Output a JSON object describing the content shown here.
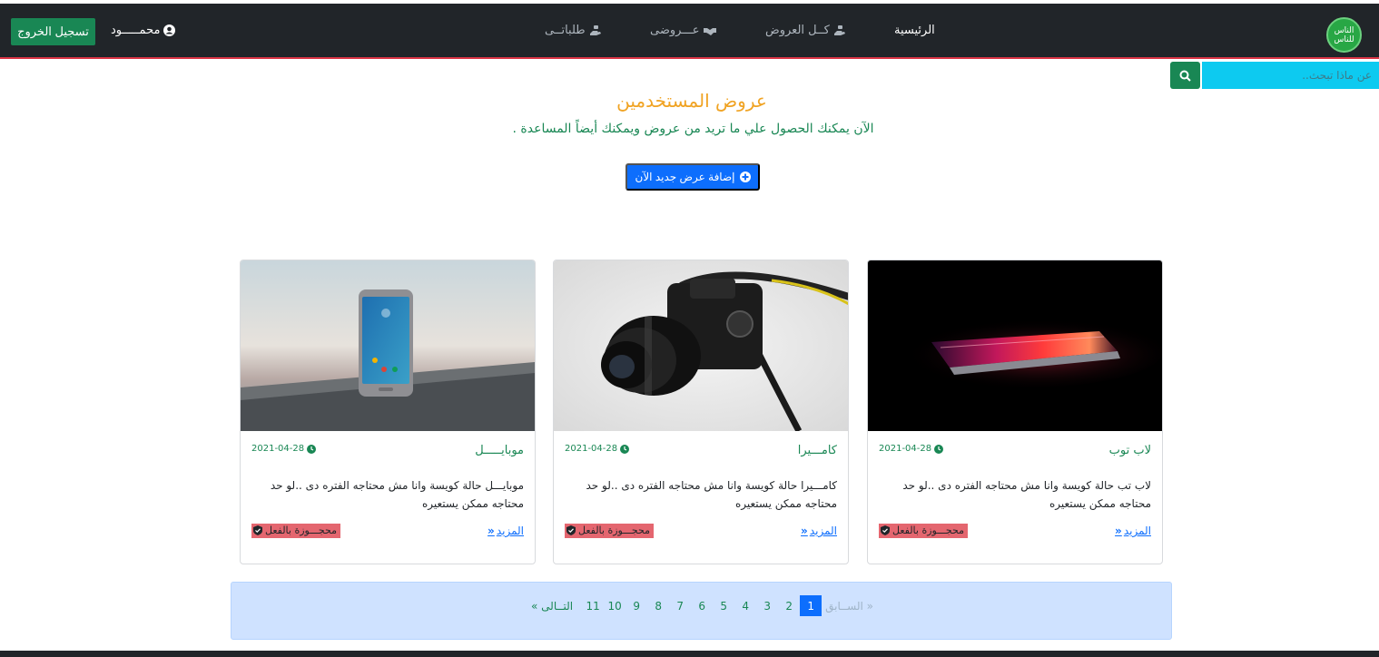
{
  "brand": {
    "logo_text": "الناس للناس"
  },
  "nav": {
    "home": "الرئيسية",
    "all_offers": "كــل العروض",
    "my_offers": "عـــروضى",
    "my_requests": "طلباتــى"
  },
  "user": {
    "name": "محمـــــود"
  },
  "logout_label": "تسجيل الخروج",
  "search": {
    "placeholder": "عن ماذا تبحث.."
  },
  "main": {
    "title": "عروض المستخدمين",
    "subtitle": "الآن يمكنك الحصول علي ما تريد من عروض ويمكنك أيضاً المساعدة .",
    "add_button": "إضافة عرض جديد الآن"
  },
  "cards": [
    {
      "title": "لاب توب",
      "date": "2021-04-28",
      "description": "لاب تب حالة كويسة وانا مش محتاجه الفتره دى ..لو حد محتاجه ممكن يستعيره",
      "more": "المزيد",
      "badge": "محجـــوزة بالفعل",
      "image": "laptop"
    },
    {
      "title": "كامـــيرا",
      "date": "2021-04-28",
      "description": "كامـــيرا حالة كويسة وانا مش محتاجه الفتره دى ..لو حد محتاجه ممكن يستعيره",
      "more": "المزيد",
      "badge": "محجـــوزة بالفعل",
      "image": "camera"
    },
    {
      "title": "موبايـــــل",
      "date": "2021-04-28",
      "description": "موبايـــل حالة كويسة وانا مش محتاجه الفتره دى ..لو حد محتاجه ممكن يستعيره",
      "more": "المزيد",
      "badge": "محجـــوزة بالفعل",
      "image": "mobile"
    }
  ],
  "pagination": {
    "prev": "« الســابق",
    "pages": [
      "1",
      "2",
      "3",
      "4",
      "5",
      "6",
      "7",
      "8",
      "9",
      "10",
      "11"
    ],
    "current": "1",
    "next": "التــالى »"
  },
  "colors": {
    "navbar": "#212529",
    "accent_green": "#198754",
    "title_orange": "#f0a323",
    "search_cyan": "#0dcaf0",
    "primary_blue": "#0d6efd",
    "badge_red": "#e4666f",
    "pager_bg": "#cfe2ff"
  }
}
